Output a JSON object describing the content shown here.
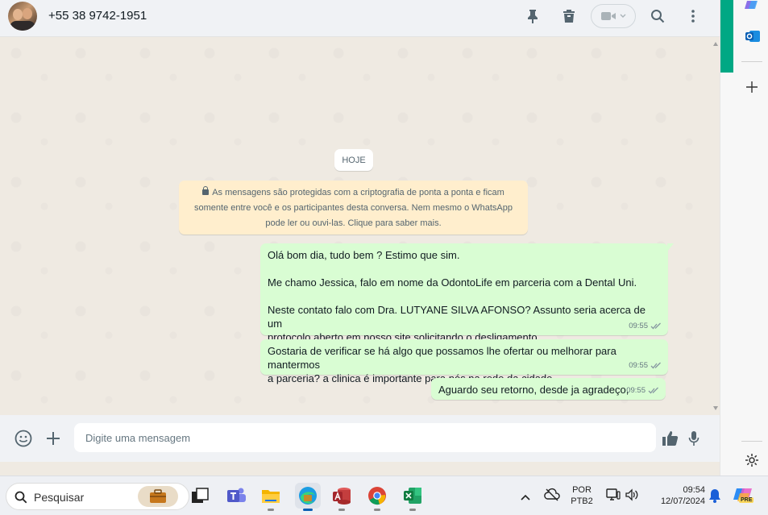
{
  "header": {
    "contact": "+55 38 9742-1951"
  },
  "chat": {
    "date_chip": "HOJE",
    "encryption_lines": [
      "As mensagens são protegidas com a criptografia de ponta a ponta e ficam",
      "somente entre você e os participantes desta conversa. Nem mesmo o WhatsApp",
      "pode ler ou ouvi-las. Clique para saber mais."
    ],
    "messages": [
      {
        "lines": [
          "Olá bom dia, tudo bem ? Estimo que sim.",
          "",
          "Me chamo Jessica, falo em nome da OdontoLife em parceria com a Dental Uni.",
          "",
          "Neste contato falo com Dra. LUTYANE SILVA AFONSO? Assunto seria acerca de um",
          "protocolo aberto em nosso site solicitando o desligamento."
        ],
        "time": "09:55"
      },
      {
        "lines": [
          "Gostaria de verificar se há algo que possamos lhe ofertar ou melhorar para mantermos",
          "a parceria? a clinica é importante para nós na rede da cidade."
        ],
        "time": "09:55"
      },
      {
        "lines": [
          "Aguardo seu retorno, desde ja agradeço,"
        ],
        "time": "09:55"
      }
    ]
  },
  "composer": {
    "placeholder": "Digite uma mensagem"
  },
  "taskbar": {
    "search_label": "Pesquisar",
    "lang_top": "POR",
    "lang_bottom": "PTB2",
    "time": "09:54",
    "date": "12/07/2024",
    "copilot_badge": "PRE"
  },
  "colors": {
    "outgoing_bubble": "#d9fdd3",
    "chat_bg": "#efeae2",
    "accent": "#00a884",
    "encryption_bg": "#ffeecd"
  }
}
